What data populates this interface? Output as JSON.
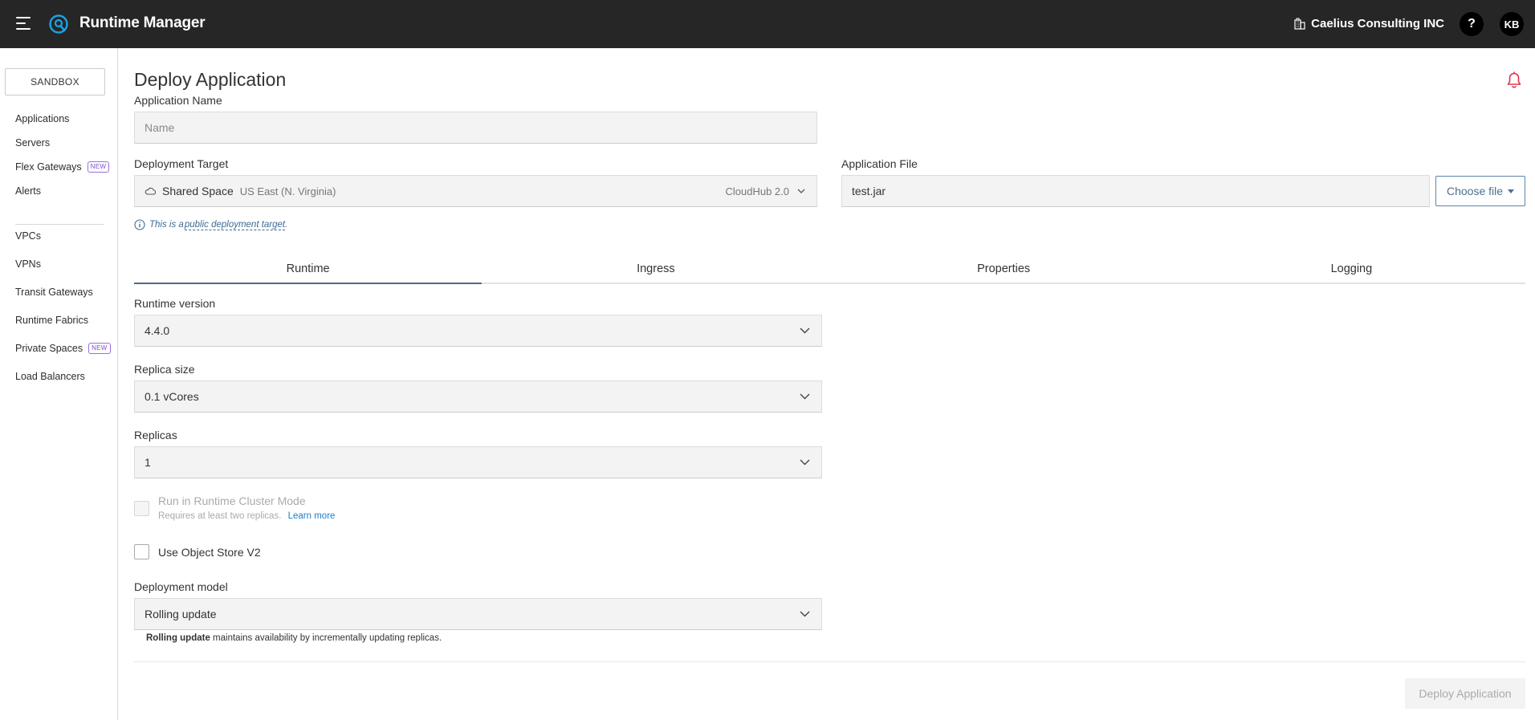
{
  "header": {
    "app_title": "Runtime Manager",
    "org_name": "Caelius Consulting INC",
    "help_label": "?",
    "avatar_initials": "KB"
  },
  "sidebar": {
    "environment": "SANDBOX",
    "items": [
      {
        "label": "Applications"
      },
      {
        "label": "Servers"
      },
      {
        "label": "Flex Gateways",
        "badge": "NEW"
      },
      {
        "label": "Alerts"
      },
      {
        "label": "VPCs"
      },
      {
        "label": "VPNs"
      },
      {
        "label": "Transit Gateways"
      },
      {
        "label": "Runtime Fabrics"
      },
      {
        "label": "Private Spaces",
        "badge": "NEW"
      },
      {
        "label": "Load Balancers"
      }
    ]
  },
  "main": {
    "title": "Deploy Application",
    "app_name": {
      "label": "Application Name",
      "placeholder": "Name",
      "value": ""
    },
    "deployment_target": {
      "label": "Deployment Target",
      "name": "Shared Space",
      "region": "US East (N. Virginia)",
      "runtime": "CloudHub 2.0"
    },
    "application_file": {
      "label": "Application File",
      "value": "test.jar",
      "choose_label": "Choose file"
    },
    "hint": {
      "prefix": "This is a ",
      "link": "public deployment target",
      "suffix": "."
    },
    "tabs": [
      {
        "label": "Runtime",
        "active": true
      },
      {
        "label": "Ingress"
      },
      {
        "label": "Properties"
      },
      {
        "label": "Logging"
      }
    ],
    "runtime_version": {
      "label": "Runtime version",
      "value": "4.4.0"
    },
    "replica_size": {
      "label": "Replica size",
      "value": "0.1 vCores"
    },
    "replicas": {
      "label": "Replicas",
      "value": "1"
    },
    "cluster_mode": {
      "label": "Run in Runtime Cluster Mode",
      "sub": "Requires at least two replicas.",
      "learn_more": "Learn more",
      "checked": false,
      "disabled": true
    },
    "object_store": {
      "label": "Use Object Store V2",
      "checked": false
    },
    "deployment_model": {
      "label": "Deployment model",
      "value": "Rolling update",
      "desc_bold": "Rolling update",
      "desc_rest": " maintains availability by incrementally updating replicas."
    },
    "deploy_button": "Deploy Application"
  },
  "colors": {
    "topbar_bg": "#262626",
    "accent": "#4b6a87",
    "link": "#1c7ec5",
    "bell": "#e0334a",
    "badge_new": "#7d4ad1"
  }
}
